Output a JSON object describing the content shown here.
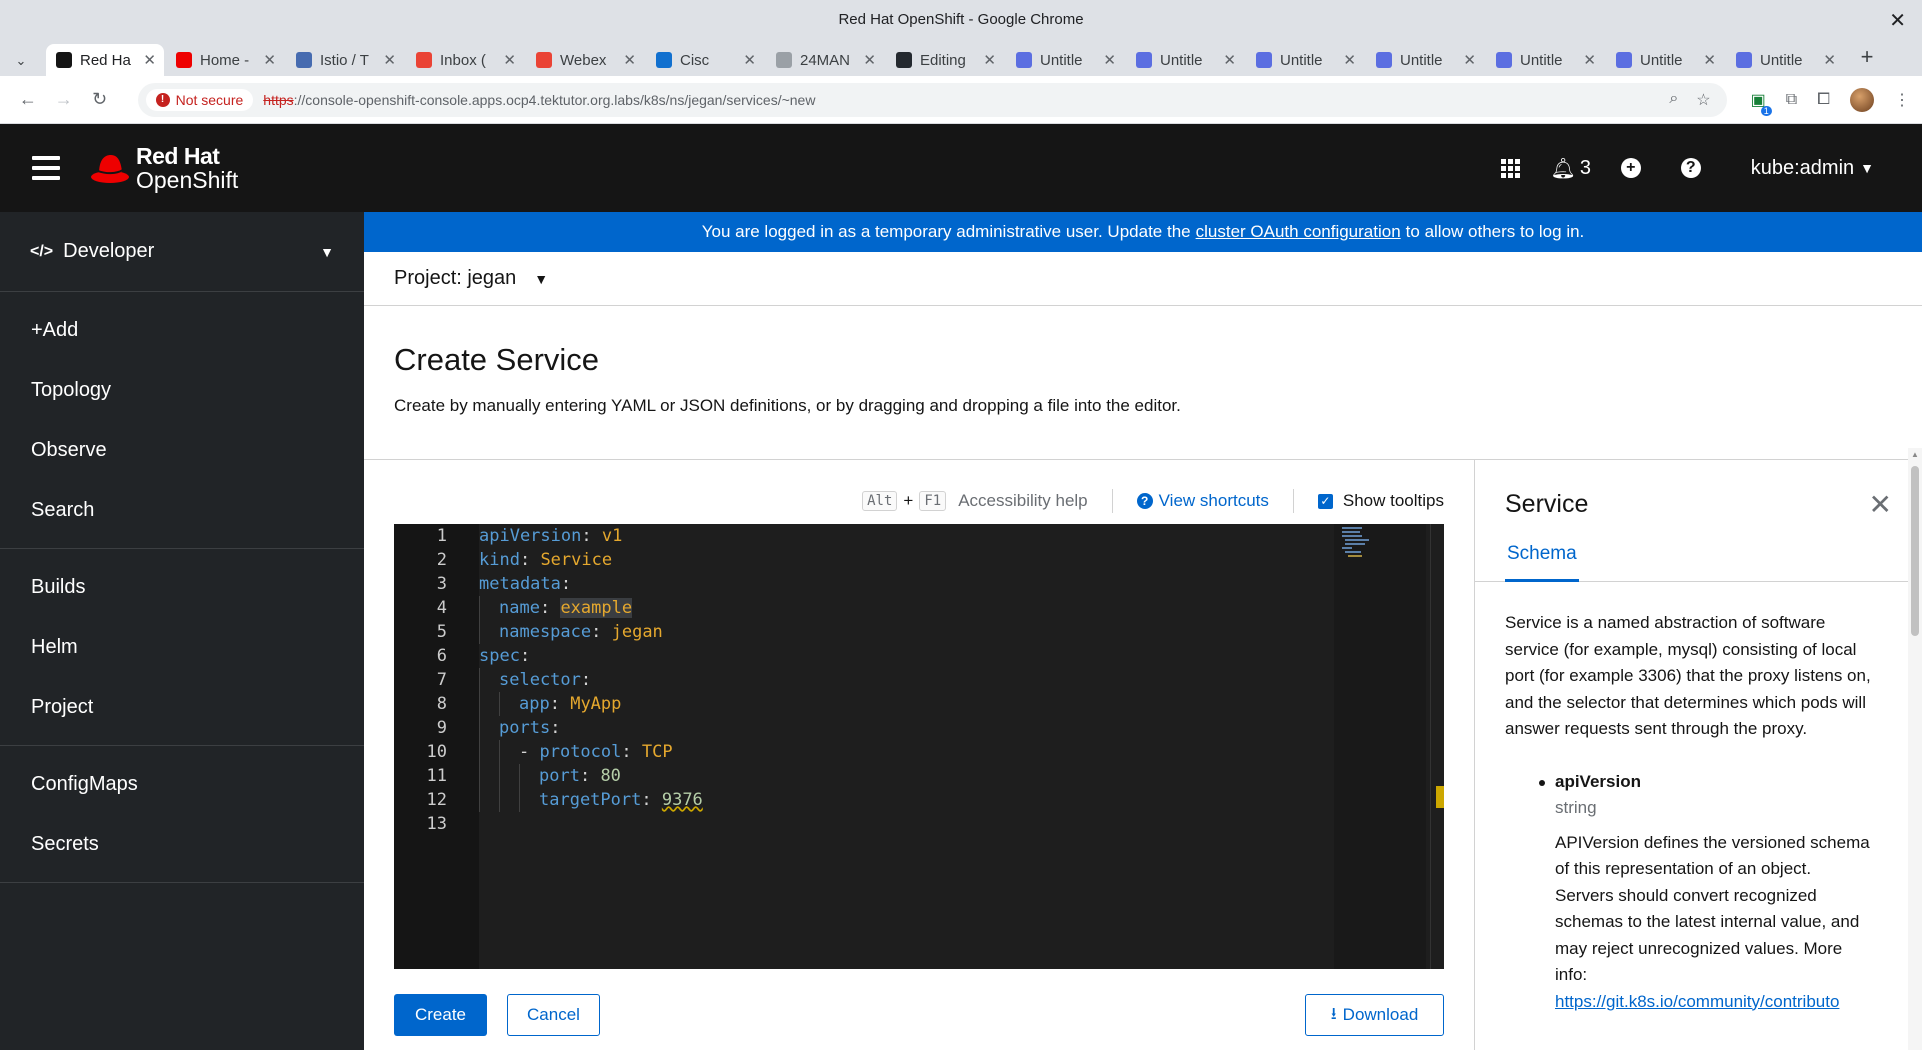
{
  "window": {
    "title": "Red Hat OpenShift - Google Chrome"
  },
  "tabs": [
    {
      "label": "Red Ha",
      "favicon": "redhat-icon",
      "color": "#151515",
      "active": true
    },
    {
      "label": "Home -",
      "favicon": "redhat-fedora-icon",
      "color": "#ee0000",
      "active": false
    },
    {
      "label": "Istio / T",
      "favicon": "istio-icon",
      "color": "#466bb0",
      "active": false
    },
    {
      "label": "Inbox (",
      "favicon": "gmail-icon",
      "color": "#ea4335",
      "active": false
    },
    {
      "label": "Webex",
      "favicon": "gmail-icon",
      "color": "#ea4335",
      "active": false
    },
    {
      "label": "Cisc",
      "favicon": "webex-icon",
      "color": "#1170cf",
      "active": false
    },
    {
      "label": "24MAN",
      "favicon": "mail-icon",
      "color": "#9aa0a6",
      "active": false
    },
    {
      "label": "Editing",
      "favicon": "github-icon",
      "color": "#24292f",
      "active": false
    },
    {
      "label": "Untitle",
      "favicon": "untitled-icon",
      "color": "#5b6ee1",
      "active": false
    },
    {
      "label": "Untitle",
      "favicon": "untitled-icon",
      "color": "#5b6ee1",
      "active": false
    },
    {
      "label": "Untitle",
      "favicon": "untitled-icon",
      "color": "#5b6ee1",
      "active": false
    },
    {
      "label": "Untitle",
      "favicon": "untitled-icon",
      "color": "#5b6ee1",
      "active": false
    },
    {
      "label": "Untitle",
      "favicon": "untitled-icon",
      "color": "#5b6ee1",
      "active": false
    },
    {
      "label": "Untitle",
      "favicon": "untitled-icon",
      "color": "#5b6ee1",
      "active": false
    },
    {
      "label": "Untitle",
      "favicon": "untitled-icon",
      "color": "#5b6ee1",
      "active": false
    }
  ],
  "omnibox": {
    "security_chip": "Not secure",
    "url_scheme": "https",
    "url_rest": "://console-openshift-console.apps.ocp4.tektutor.org.labs/k8s/ns/jegan/services/~new",
    "extension_badge": "1"
  },
  "masthead": {
    "brand_line1": "Red Hat",
    "brand_line2": "OpenShift",
    "notifications_count": "3",
    "user": "kube:admin"
  },
  "sidebar": {
    "perspective": "Developer",
    "groups": [
      [
        "+Add",
        "Topology",
        "Observe",
        "Search"
      ],
      [
        "Builds",
        "Helm",
        "Project"
      ],
      [
        "ConfigMaps",
        "Secrets"
      ]
    ]
  },
  "banner": {
    "prefix": "You are logged in as a temporary administrative user. Update the",
    "link": "cluster OAuth configuration",
    "suffix": "to allow others to log in."
  },
  "project": {
    "label": "Project: jegan"
  },
  "page": {
    "title": "Create Service",
    "description": "Create by manually entering YAML or JSON definitions, or by dragging and dropping a file into the editor."
  },
  "editor_toolbar": {
    "key1": "Alt",
    "plus": "+",
    "key2": "F1",
    "accessibility_help": "Accessibility help",
    "view_shortcuts": "View shortcuts",
    "show_tooltips": "Show tooltips"
  },
  "code": {
    "line_numbers": [
      "1",
      "2",
      "3",
      "4",
      "5",
      "6",
      "7",
      "8",
      "9",
      "10",
      "11",
      "12",
      "13"
    ],
    "lines": [
      {
        "indent": 0,
        "dash": "",
        "key": "apiVersion",
        "value": "v1",
        "vclass": "v"
      },
      {
        "indent": 0,
        "dash": "",
        "key": "kind",
        "value": "Service",
        "vclass": "v"
      },
      {
        "indent": 0,
        "dash": "",
        "key": "metadata",
        "value": "",
        "vclass": "v"
      },
      {
        "indent": 1,
        "dash": "",
        "key": "name",
        "value": "example",
        "vclass": "v hl"
      },
      {
        "indent": 1,
        "dash": "",
        "key": "namespace",
        "value": "jegan",
        "vclass": "v"
      },
      {
        "indent": 0,
        "dash": "",
        "key": "spec",
        "value": "",
        "vclass": "v"
      },
      {
        "indent": 1,
        "dash": "",
        "key": "selector",
        "value": "",
        "vclass": "v"
      },
      {
        "indent": 2,
        "dash": "",
        "key": "app",
        "value": "MyApp",
        "vclass": "v"
      },
      {
        "indent": 1,
        "dash": "",
        "key": "ports",
        "value": "",
        "vclass": "v"
      },
      {
        "indent": 2,
        "dash": "- ",
        "key": "protocol",
        "value": "TCP",
        "vclass": "v"
      },
      {
        "indent": 3,
        "dash": "",
        "key": "port",
        "value": "80",
        "vclass": "n"
      },
      {
        "indent": 3,
        "dash": "",
        "key": "targetPort",
        "value": "9376",
        "vclass": "n squig"
      },
      {
        "indent": 0,
        "dash": "",
        "key": "",
        "value": "",
        "vclass": "v"
      }
    ]
  },
  "buttons": {
    "create": "Create",
    "cancel": "Cancel",
    "download": "Download"
  },
  "schema_panel": {
    "title": "Service",
    "tab": "Schema",
    "description": "Service is a named abstraction of software service (for example, mysql) consisting of local port (for example 3306) that the proxy listens on, and the selector that determines which pods will answer requests sent through the proxy.",
    "field_name": "apiVersion",
    "field_type": "string",
    "field_desc": "APIVersion defines the versioned schema of this representation of an object. Servers should convert recognized schemas to the latest internal value, and may reject unrecognized values. More info:",
    "field_link": "https://git.k8s.io/community/contributo"
  },
  "colors": {
    "accent": "#0066cc",
    "masthead": "#151515",
    "sidebar": "#212427",
    "editor_bg": "#1e1e1e"
  }
}
